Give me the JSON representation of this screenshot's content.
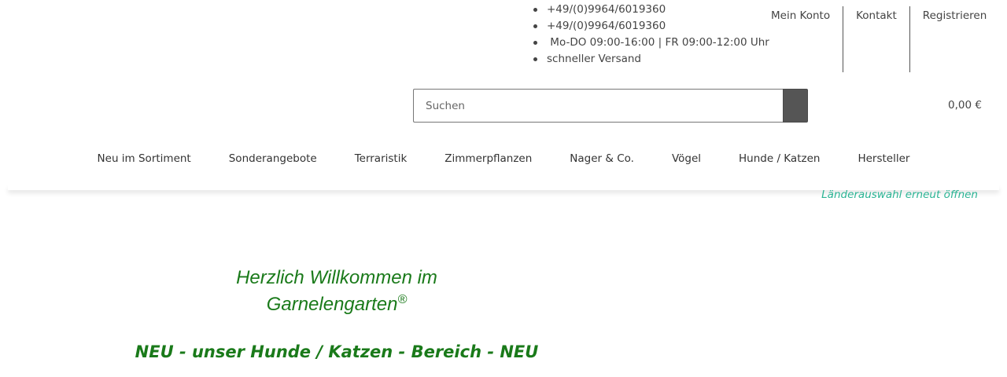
{
  "header": {
    "info_items": [
      "+49/(0)9964/6019360",
      "+49/(0)9964/6019360",
      " Mo-DO 09:00-16:00 | FR 09:00-12:00 Uhr",
      "schneller Versand"
    ],
    "top_links": [
      "Mein Konto",
      "Kontakt",
      "Registrieren"
    ]
  },
  "search": {
    "placeholder": "Suchen",
    "value": ""
  },
  "cart": {
    "total": "0,00 €"
  },
  "nav": {
    "categories": [
      "Neu im Sortiment",
      "Sonderangebote",
      "Terraristik",
      "Zimmerpflanzen",
      "Nager & Co.",
      "Vögel",
      "Hunde / Katzen",
      "Hersteller"
    ]
  },
  "country_link": "Länderauswahl erneut öffnen",
  "content": {
    "welcome_line1": "Herzlich Willkommen im",
    "welcome_line2": "Garnelengarten",
    "welcome_mark": "®",
    "new_banner": "NEU - unser Hunde / Katzen - Bereich - NEU"
  },
  "colors": {
    "accent_green": "#1a7a1a",
    "link_teal": "#2bb494",
    "search_button": "#555555"
  }
}
